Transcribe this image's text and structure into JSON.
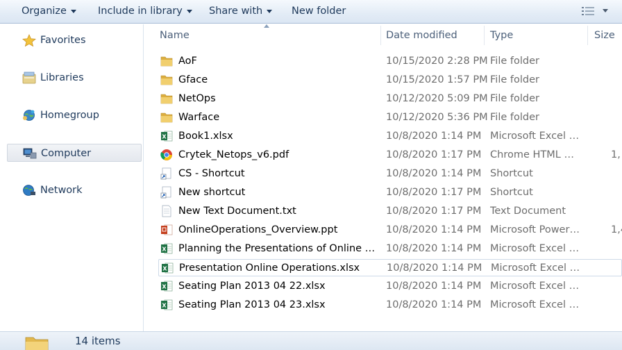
{
  "toolbar": {
    "organize": "Organize",
    "include_in_library": "Include in library",
    "share_with": "Share with",
    "new_folder": "New folder",
    "view_icon": "details-view-icon"
  },
  "nav": {
    "items": [
      {
        "label": "Favorites",
        "icon": "star-icon"
      },
      {
        "label": "Libraries",
        "icon": "libraries-icon"
      },
      {
        "label": "Homegroup",
        "icon": "homegroup-icon"
      },
      {
        "label": "Computer",
        "icon": "computer-icon",
        "selected": true
      },
      {
        "label": "Network",
        "icon": "network-icon"
      }
    ]
  },
  "columns": {
    "name": "Name",
    "date_modified": "Date modified",
    "type": "Type",
    "size": "Size"
  },
  "files": [
    {
      "name": "AoF",
      "date": "10/15/2020 2:28 PM",
      "type": "File folder",
      "size": "",
      "icon": "folder-icon"
    },
    {
      "name": "Gface",
      "date": "10/15/2020 1:57 PM",
      "type": "File folder",
      "size": "",
      "icon": "folder-icon"
    },
    {
      "name": "NetOps",
      "date": "10/12/2020 5:09 PM",
      "type": "File folder",
      "size": "",
      "icon": "folder-icon"
    },
    {
      "name": "Warface",
      "date": "10/12/2020 5:36 PM",
      "type": "File folder",
      "size": "",
      "icon": "folder-icon"
    },
    {
      "name": "Book1.xlsx",
      "date": "10/8/2020 1:14 PM",
      "type": "Microsoft Excel W...",
      "size": "",
      "icon": "excel-icon"
    },
    {
      "name": "Crytek_Netops_v6.pdf",
      "date": "10/8/2020 1:17 PM",
      "type": "Chrome HTML Do...",
      "size": "1,",
      "icon": "chrome-icon"
    },
    {
      "name": "CS - Shortcut",
      "date": "10/8/2020 1:14 PM",
      "type": "Shortcut",
      "size": "",
      "icon": "shortcut-icon"
    },
    {
      "name": "New shortcut",
      "date": "10/8/2020 1:17 PM",
      "type": "Shortcut",
      "size": "",
      "icon": "shortcut-icon"
    },
    {
      "name": "New Text Document.txt",
      "date": "10/8/2020 1:17 PM",
      "type": "Text Document",
      "size": "",
      "icon": "text-file-icon"
    },
    {
      "name": "OnlineOperations_Overview.ppt",
      "date": "10/8/2020 1:14 PM",
      "type": "Microsoft PowerP...",
      "size": "1,4",
      "icon": "powerpoint-icon"
    },
    {
      "name": "Planning the Presentations of Online Ope...",
      "date": "10/8/2020 1:14 PM",
      "type": "Microsoft Excel W...",
      "size": "",
      "icon": "excel-icon"
    },
    {
      "name": "Presentation Online Operations.xlsx",
      "date": "10/8/2020 1:14 PM",
      "type": "Microsoft Excel W...",
      "size": "",
      "icon": "excel-icon",
      "selected": true
    },
    {
      "name": "Seating Plan 2013 04 22.xlsx",
      "date": "10/8/2020 1:14 PM",
      "type": "Microsoft Excel W...",
      "size": "",
      "icon": "excel-icon"
    },
    {
      "name": "Seating Plan 2013 04 23.xlsx",
      "date": "10/8/2020 1:14 PM",
      "type": "Microsoft Excel W...",
      "size": "",
      "icon": "excel-icon"
    }
  ],
  "status": {
    "count_text": "14 items",
    "icon": "folder-icon"
  },
  "colors": {
    "toolbar_text": "#1e395b",
    "folder": "#e9c25a",
    "excel": "#1f7244"
  }
}
